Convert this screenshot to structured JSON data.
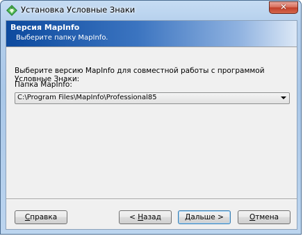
{
  "window": {
    "title": "Установка Условные Знаки",
    "close_label": "✕"
  },
  "header": {
    "title": "Версия MapInfo",
    "subtitle": "Выберите папку MapInfo."
  },
  "main": {
    "prompt": "Выберите версию MapInfo для совместной работы с программой Условные Знаки:",
    "folder_label": "Папка MapInfo:",
    "folder_value": "C:\\Program Files\\MapInfo\\Professional85"
  },
  "buttons": {
    "help": {
      "accel": "С",
      "rest": "правка"
    },
    "back": {
      "prefix": "< ",
      "accel": "Н",
      "rest": "азад"
    },
    "next": {
      "accel": "Д",
      "rest": "альше >"
    },
    "cancel": {
      "accel": "О",
      "rest": "тмена"
    }
  },
  "colors": {
    "header_gradient_start": "#0d4a9e",
    "header_gradient_end": "#dce8f6",
    "close_button": "#c2402a",
    "default_button_border": "#3c7fb1"
  },
  "icons": {
    "app_icon": "green-diamond-arrows-icon",
    "dropdown": "chevron-down-icon"
  }
}
